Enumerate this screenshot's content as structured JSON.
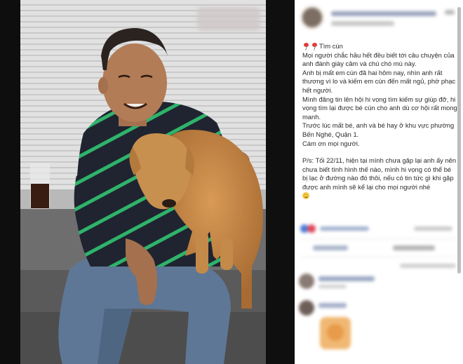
{
  "post": {
    "title": "Tìm cún",
    "paragraph_1": "Mọi người chắc hầu hết đều biết tới câu chuyện của anh đánh giày câm và chú chó mù này.",
    "paragraph_2": "Anh bị mất em cún đã hai hôm nay, nhìn anh rất thương vì lo và kiếm em cún đến mất ngủ, phờ phạc hết người.",
    "paragraph_3": "Mình đăng tin lên hội hi vọng tìm kiếm sự giúp đỡ, hi vọng tìm lại được bé cún cho anh dù cơ hội rất mong manh.",
    "paragraph_4": "Trước lúc mất bé, anh và bé hay ở khu vực phường Bến Nghé, Quận 1.",
    "thanks": "Cám ơn mọi người.",
    "ps": "P/s: Tối 22/11, hiện tại mình chưa gặp lại anh ấy nên chưa biết tình hình thế nào, mình hi vọng có thể bé bị lạc ở đường nào đó thôi, nếu có tin tức gì khi gặp được anh mình sẽ kể lại cho mọi người nhé"
  },
  "icons": {
    "pin": "pushpin-icon",
    "smile": "smiling-face-icon",
    "avatar": "profile-avatar"
  },
  "colors": {
    "page_background": "#0e0e0e",
    "post_background": "#ffffff",
    "text": "#2b2b2b",
    "shirt": "#1f2430",
    "shirt_stripe": "#2fb36a",
    "dog_fur": "#c48a4a"
  }
}
